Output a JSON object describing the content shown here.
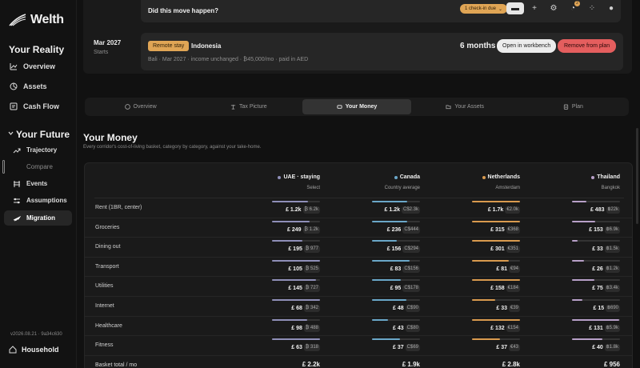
{
  "app": {
    "name": "Welth",
    "version": "v2026.08.21 · 9a34c630",
    "household_label": "Household"
  },
  "sidebar": {
    "reality_title": "Your Reality",
    "reality_items": [
      {
        "label": "Overview",
        "icon": "trend-icon"
      },
      {
        "label": "Assets",
        "icon": "pie-icon"
      },
      {
        "label": "Cash Flow",
        "icon": "receipt-icon"
      }
    ],
    "future_title": "Your Future",
    "future_items": [
      {
        "label": "Trajectory",
        "icon": "trend-up-icon",
        "state": "normal"
      },
      {
        "label": "Compare",
        "icon": "",
        "state": "dim"
      },
      {
        "label": "Events",
        "icon": "calendar-icon",
        "state": "normal"
      },
      {
        "label": "Assumptions",
        "icon": "sliders-icon",
        "state": "normal"
      },
      {
        "label": "Migration",
        "icon": "plane-icon",
        "state": "active"
      }
    ]
  },
  "top": {
    "question": "Did this move happen?",
    "checkin_badge": "1 check-in due",
    "toolbar_badge_count": "2",
    "event": {
      "date": "Mar 2027",
      "date_sub": "Starts",
      "tag": "Remote stay",
      "title": "Indonesia",
      "meta": "Bali · Mar 2027 · income unchanged · ₿45,000/mo · paid in AED",
      "duration": "6 months",
      "open_label": "Open in workbench",
      "remove_label": "Remove from plan"
    }
  },
  "tabs": [
    {
      "label": "Overview",
      "active": false
    },
    {
      "label": "Tax Picture",
      "active": false
    },
    {
      "label": "Your Money",
      "active": true
    },
    {
      "label": "Your Assets",
      "active": false
    },
    {
      "label": "Plan",
      "active": false
    }
  ],
  "section": {
    "title": "Your Money",
    "subtitle": "Every corridor's cost-of-living basket, category by category, against your take-home."
  },
  "colors": {
    "uae": "#8f8fb8",
    "canada": "#6aa7c8",
    "netherlands": "#d99a4e",
    "thailand": "#b8a0c8"
  },
  "table": {
    "columns": [
      {
        "name": "UAE · staying",
        "sub": "Select",
        "color": "#8f8fb8"
      },
      {
        "name": "Canada",
        "sub": "Country average",
        "color": "#6aa7c8"
      },
      {
        "name": "Netherlands",
        "sub": "Amsterdam",
        "color": "#d99a4e"
      },
      {
        "name": "Thailand",
        "sub": "Bangkok",
        "color": "#b8a0c8"
      }
    ],
    "rows": [
      {
        "label": "Rent (1BR, center)",
        "cells": [
          {
            "main": "£ 1.2k",
            "local": "₿ 6.2k",
            "fill": 0.75
          },
          {
            "main": "£ 1.2k",
            "local": "C$2.3k",
            "fill": 0.74
          },
          {
            "main": "£ 1.7k",
            "local": "€2.0k",
            "fill": 1.0
          },
          {
            "main": "£ 483",
            "local": "฿22k",
            "fill": 0.3
          }
        ]
      },
      {
        "label": "Groceries",
        "cells": [
          {
            "main": "£ 249",
            "local": "₿ 1.2k",
            "fill": 0.78
          },
          {
            "main": "£ 236",
            "local": "C$444",
            "fill": 0.74
          },
          {
            "main": "£ 315",
            "local": "€368",
            "fill": 1.0
          },
          {
            "main": "£ 153",
            "local": "฿6.9k",
            "fill": 0.48
          }
        ]
      },
      {
        "label": "Dining out",
        "cells": [
          {
            "main": "£ 195",
            "local": "₿ 977",
            "fill": 0.64
          },
          {
            "main": "£ 156",
            "local": "C$294",
            "fill": 0.52
          },
          {
            "main": "£ 301",
            "local": "€351",
            "fill": 1.0
          },
          {
            "main": "£ 33",
            "local": "฿1.5k",
            "fill": 0.11
          }
        ]
      },
      {
        "label": "Transport",
        "cells": [
          {
            "main": "£ 105",
            "local": "₿ 525",
            "fill": 1.0
          },
          {
            "main": "£ 83",
            "local": "C$156",
            "fill": 0.79
          },
          {
            "main": "£ 81",
            "local": "€94",
            "fill": 0.77
          },
          {
            "main": "£ 26",
            "local": "฿1.2k",
            "fill": 0.25
          }
        ]
      },
      {
        "label": "Utilities",
        "cells": [
          {
            "main": "£ 145",
            "local": "₿ 727",
            "fill": 0.92
          },
          {
            "main": "£ 95",
            "local": "C$178",
            "fill": 0.6
          },
          {
            "main": "£ 158",
            "local": "€184",
            "fill": 1.0
          },
          {
            "main": "£ 75",
            "local": "฿3.4k",
            "fill": 0.47
          }
        ]
      },
      {
        "label": "Internet",
        "cells": [
          {
            "main": "£ 68",
            "local": "₿ 342",
            "fill": 1.0
          },
          {
            "main": "£ 48",
            "local": "C$90",
            "fill": 0.71
          },
          {
            "main": "£ 33",
            "local": "€39",
            "fill": 0.49
          },
          {
            "main": "£ 15",
            "local": "฿690",
            "fill": 0.22
          }
        ]
      },
      {
        "label": "Healthcare",
        "cells": [
          {
            "main": "£ 98",
            "local": "₿ 488",
            "fill": 0.74
          },
          {
            "main": "£ 43",
            "local": "C$80",
            "fill": 0.33
          },
          {
            "main": "£ 132",
            "local": "€154",
            "fill": 1.0
          },
          {
            "main": "£ 131",
            "local": "฿5.9k",
            "fill": 0.99
          }
        ]
      },
      {
        "label": "Fitness",
        "cells": [
          {
            "main": "£ 63",
            "local": "₿ 318",
            "fill": 1.0
          },
          {
            "main": "£ 37",
            "local": "C$69",
            "fill": 0.59
          },
          {
            "main": "£ 37",
            "local": "€43",
            "fill": 0.59
          },
          {
            "main": "£ 40",
            "local": "฿1.8k",
            "fill": 0.63
          }
        ]
      }
    ],
    "total": {
      "label": "Basket total / mo",
      "values": [
        "£ 2.2k",
        "£ 1.9k",
        "£ 2.8k",
        "£ 956"
      ]
    }
  }
}
